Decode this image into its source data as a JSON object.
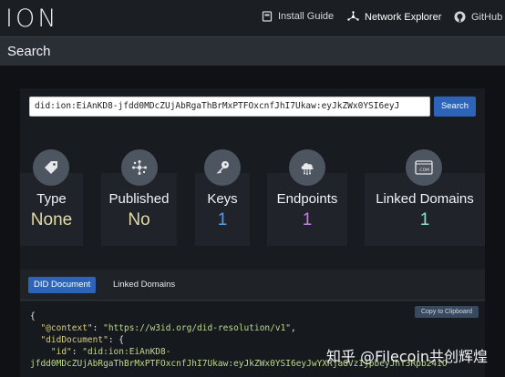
{
  "nav": {
    "logo": "ION",
    "install_guide": "Install Guide",
    "network_explorer": "Network Explorer",
    "github": "GitHub"
  },
  "search": {
    "title": "Search",
    "input_value": "did:ion:EiAnKD8-jfdd0MDcZUjAbRgaThBrMxPTFOxcnfJhI7Ukaw:eyJkZWx0YSI6eyJ",
    "button_label": "Search"
  },
  "stats": [
    {
      "label": "Type",
      "value": "None",
      "icon": "tag-icon",
      "color": "#e3d9a6"
    },
    {
      "label": "Published",
      "value": "No",
      "icon": "network-icon",
      "color": "#e3d9a6"
    },
    {
      "label": "Keys",
      "value": "1",
      "icon": "key-icon",
      "color": "#5a9be8"
    },
    {
      "label": "Endpoints",
      "value": "1",
      "icon": "cloud-icon",
      "color": "#c77ae8"
    },
    {
      "label": "Linked Domains",
      "value": "1",
      "icon": "domain-icon",
      "color": "#8de0c0"
    }
  ],
  "tabs": {
    "did_document": "DID Document",
    "linked_domains": "Linked Domains"
  },
  "copy_label": "Copy to Clipboard",
  "code": {
    "line1": "{",
    "context_key": "\"@context\"",
    "context_value": "\"https://w3id.org/did-resolution/v1\"",
    "doc_key": "\"didDocument\"",
    "id_key": "\"id\"",
    "id_value_part1": "\"did:ion:EiAnKD8-",
    "id_value_part2": "jfdd0MDcZUjAbRgaThBrMxPTFOxcnfJhI7Ukaw:eyJkZWx0YSI6eyJwYXRjaGVzIjpbeyJhY3Rpb24iO"
  },
  "watermark": "知乎 @Filecoin共创辉煌"
}
